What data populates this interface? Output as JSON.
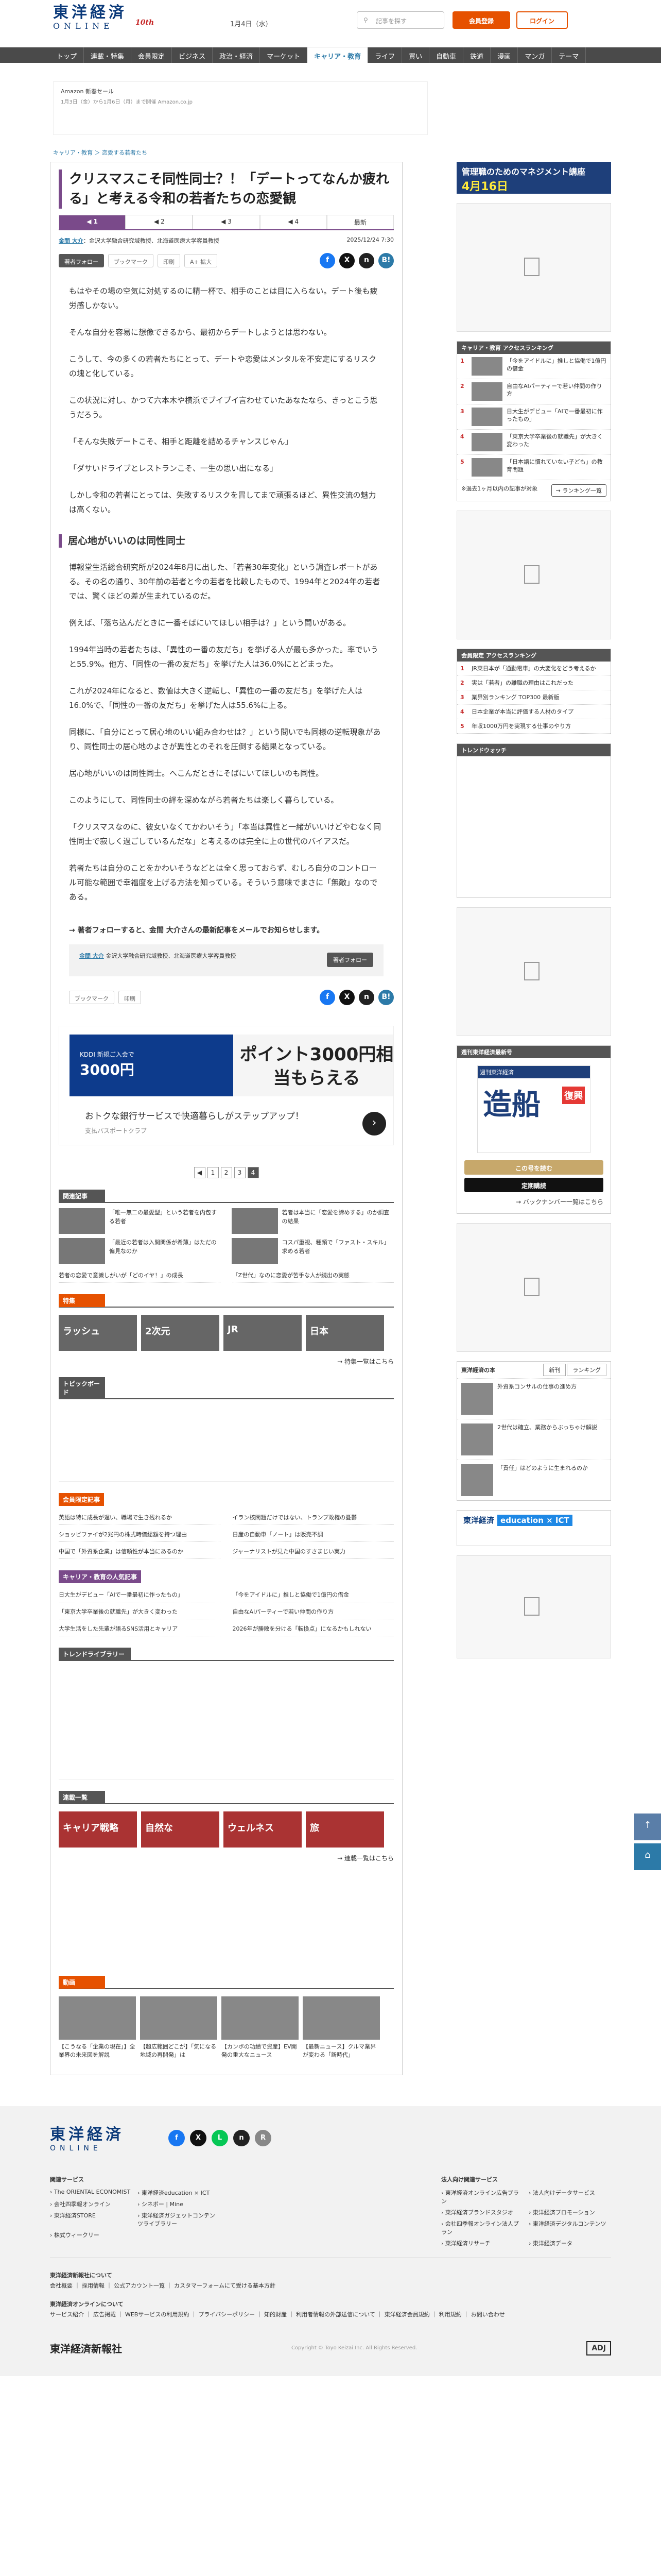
{
  "header": {
    "logo_main": "東洋経済",
    "logo_sub": "ONLINE",
    "logo_badge": "10th",
    "date": "1月4日（水）",
    "search_placeholder": "記事を探す",
    "register_label": "会員登録",
    "login_label": "ログイン"
  },
  "nav": [
    "トップ",
    "連載・特集",
    "会員限定",
    "ビジネス",
    "政治・経済",
    "マーケット",
    "キャリア・教育",
    "ライフ",
    "買い",
    "自動車",
    "鉄道",
    "漫画",
    "マンガ",
    "テーマ"
  ],
  "nav_active": 6,
  "ad_top": {
    "line1": "Amazon 新春セール",
    "line2": "1月3日（金）から1月6日（月）まで開催 Amazon.co.jp"
  },
  "breadcrumb": "キャリア・教育 ＞ 恋愛する若者たち",
  "article": {
    "title": "クリスマスこそ同性同士？！「デートってなんか疲れる」と考える令和の若者たちの恋愛観",
    "pages": [
      "1",
      "2",
      "3",
      "4",
      "最新"
    ],
    "author": "金間 大介",
    "author_desc": "：金沢大学融合研究域教授、北海道医療大学客員教授",
    "datetime": "2025/12/24 7:30",
    "follow_label": "著者フォロー",
    "bookmark_label": "ブックマーク",
    "print_label": "印刷",
    "font_label": "A+ 拡大",
    "paragraphs": [
      "もはやその場の空気に対処するのに精一杯で、相手のことは目に入らない。デート後も疲労感しかない。",
      "そんな自分を容易に想像できるから、最初からデートしようとは思わない。",
      "こうして、今の多くの若者たちにとって、デートや恋愛はメンタルを不安定にするリスクの塊と化している。",
      "この状況に対し、かつて六本木や横浜でブイブイ言わせていたあなたなら、きっとこう思うだろう。",
      "「そんな失敗デートこそ、相手と距離を詰めるチャンスじゃん」",
      "「ダサいドライブとレストランこそ、一生の思い出になる」",
      "しかし令和の若者にとっては、失敗するリスクを冒してまで頑張るほど、異性交流の魅力は高くない。"
    ],
    "h2": "居心地がいいのは同性同士",
    "paragraphs2": [
      "博報堂生活総合研究所が2024年8月に出した、「若者30年変化」という調査レポートがある。その名の通り、30年前の若者と今の若者を比較したもので、1994年と2024年の若者では、驚くほどの差が生まれているのだ。",
      "例えば、「落ち込んだときに一番そばにいてほしい相手は？」という問いがある。",
      "1994年当時の若者たちは、「異性の一番の友だち」を挙げる人が最も多かった。率でいうと55.9%。他方、「同性の一番の友だち」を挙げた人は36.0%にとどまった。",
      "これが2024年になると、数値は大きく逆転し、「異性の一番の友だち」を挙げた人は16.0%で、「同性の一番の友だち」を挙げた人は55.6%に上る。",
      "同様に、「自分にとって居心地のいい組み合わせは？」という問いでも同様の逆転現象があり、同性同士の居心地のよさが異性とのそれを圧倒する結果となっている。",
      "居心地がいいのは同性同士。へこんだときにそばにいてほしいのも同性。",
      "このようにして、同性同士の絆を深めながら若者たちは楽しく暮らしている。",
      "「クリスマスなのに、彼女いなくてかわいそう」「本当は異性と一緒がいいけどやむなく同性同士で寂しく過ごしているんだな」と考えるのは完全に上の世代のバイアスだ。",
      "若者たちは自分のことをかわいそうなどとは全く思っておらず、むしろ自分のコントロール可能な範囲で幸福度を上げる方法を知っている。そういう意味でまさに「無敵」なのである。"
    ],
    "follow_note": "→ 著者フォローすると、金間 大介さんの最新記事をメールでお知らせします。",
    "author_box_desc": "金沢大学融合研究域教授、北海道医療大学客員教授",
    "author_box_follow": "著者フォロー"
  },
  "ad_mid": {
    "left_big": "3000円",
    "left_small": "KDDI 新規ご入会で",
    "right": "ポイント3000円相当もらえる",
    "text": "おトクな銀行サービスで快適暮らしがステップアップ！",
    "sub": "支払パスポートクラブ"
  },
  "page_numbers": [
    "1",
    "2",
    "3",
    "4"
  ],
  "page_current": 3,
  "related": {
    "head": "関連記事",
    "items": [
      "「唯一無二の最愛型」という若者を内包する若者",
      "若者は本当に「恋愛を諦めする」のか調査の結果",
      "「最近の若者は入間関係が希薄」はただの偏見なのか",
      "コスパ重視、種類で「ファスト・スキル」求める若者"
    ],
    "text_items": [
      "若者の恋愛で意識しがいが「どのイヤ！」の成長",
      "「Z世代」なのに恋愛が苦手な人が続出の実態"
    ]
  },
  "mini_thumbs": [
    "ラッシュ",
    "2次元",
    "JR",
    "日本"
  ],
  "more_label": "→ 特集一覧はこちら",
  "sec_pickup": "トピックボード",
  "sec_hot": "会員限定記事",
  "hot_items": [
    "英語は特に成長が遅い、職場で生き残れるか",
    "イラン核問題だけではない、トランプ政権の憂鬱",
    "ショッピファイが2兆円の株式時価総額を持つ理由",
    "日産の自動車「ノート」は販売不調",
    "中国で「外資系企業」は信頼性が本当にあるのか",
    "ジャーナリストが見た中国のすさまじい実力"
  ],
  "sec_career": "キャリア・教育の人気記事",
  "career_items": [
    "日大生がデビュー「AIで一番最初に作ったもの」",
    "「今をアイドルに」推しと協働で1億円の借金",
    "「東京大学卒業後の就職先」が大きく変わった",
    "自由なAIパーティーで若い仲間の作り方",
    "大学生活をした先輩が語るSNS活用とキャリア",
    "2026年が勝敗を分ける「転換点」になるかもしれない"
  ],
  "sec_topics": "トレンドライブラリー",
  "sec_feat": "連載一覧",
  "feat_thumbs": [
    "キャリア戦略",
    "自然な",
    "ウェルネス",
    "旅"
  ],
  "feat_more": "→ 連載一覧はこちら",
  "sec_movie": "動画",
  "movie_items": [
    "【こうなる「企業の現在」】全業界の未来図を解説",
    "【超広範囲どこが】「気になる地域の再開発」は",
    "【カンボの功績で資産】EV開発の重大なニュース",
    "【最新ニュース】クルマ業界が変わる「新時代」"
  ],
  "sidebar": {
    "banner_top": "管理職のためのマネジメント講座",
    "banner_date": "4月16日",
    "ranking_head": "キャリア・教育 アクセスランキング",
    "ranking": [
      "「今をアイドルに」推しと協働で1億円の借金",
      "自由なAIパーティーで若い仲間の作り方",
      "日大生がデビュー「AIで一番最初に作ったもの」",
      "「東京大学卒業後の就職先」が大きく変わった",
      "「日本語に慣れていない子ども」の教育問題"
    ],
    "ranking_note": "※過去1ヶ月以内の記事が対象",
    "ranking_more": "→ ランキング一覧",
    "ranking2_head": "会員限定 アクセスランキング",
    "ranking2": [
      "JR東日本が「通勤電車」の大変化をどう考えるか",
      "実は「若者」の離職の理由はこれだった",
      "業界別ランキング TOP300 最新版",
      "日本企業が本当に評価する人材のタイプ",
      "年収1000万円を実現する仕事のやり方"
    ],
    "trend_head": "トレンドウォッチ",
    "mag_head": "週刊東洋経済最新号",
    "mag_title": "造船",
    "mag_tag": "復興",
    "mag_sub": "週刊東洋経済",
    "mag_buy": "この号を読む",
    "mag_sub_btn": "定期購読",
    "mag_back": "→ バックナンバー一覧はこちら",
    "rank_head": "東洋経済の本",
    "rank_tabs": [
      "新刊",
      "ランキング"
    ],
    "rank_items": [
      "外資系コンサルの仕事の進め方",
      "2世代は確立、業務からぶっちゃけ解説",
      "「責任」はどのように生まれるのか"
    ],
    "ict_label": "東洋経済",
    "ict_badge": "education × ICT"
  },
  "footer": {
    "logo_main": "東洋経済",
    "logo_sub": "ONLINE",
    "col1_head": "関連サービス",
    "col1": [
      "The ORIENTAL ECONOMIST",
      "東洋経済education × ICT",
      "会社四季報オンライン",
      "シネボー | Mine",
      "東洋経済STORE",
      "東洋経済ガジェットコンテンツライブラリー",
      "株式ウィークリー"
    ],
    "col2_head": "法人向け関連サービス",
    "col2": [
      "東洋経済オンライン広告プラン",
      "法人向けデータサービス",
      "東洋経済ブランドスタジオ",
      "東洋経済プロモーション",
      "会社四季報オンライン法人プラン",
      "東洋経済デジタルコンテンツ",
      "東洋経済リサーチ",
      "東洋経済データ"
    ],
    "about_head": "東洋経済新報社について",
    "about": "会社概要 ｜ 採用情報 ｜ 公式アカウント一覧 ｜ カスタマーフォームにて受ける基本方針",
    "online_head": "東洋経済オンラインについて",
    "online": "サービス紹介 ｜ 広告掲載 ｜ WEBサービスの利用規約 ｜ プライバシーポリシー ｜ 知的財産 ｜ 利用者情報の外部送信について ｜ 東洋経済会員規約 ｜ 利用規約 ｜ お問い合わせ",
    "publisher": "東洋経済新報社",
    "copyright": "Copyright © Toyo Keizai Inc. All Rights Reserved.",
    "adj": "ADJ"
  },
  "placeholders": {
    "ad": "広告",
    "video": "動画"
  },
  "colors": {
    "accent": "#7a4a8a",
    "brand": "#0b3a7a",
    "cta": "#e65100"
  }
}
